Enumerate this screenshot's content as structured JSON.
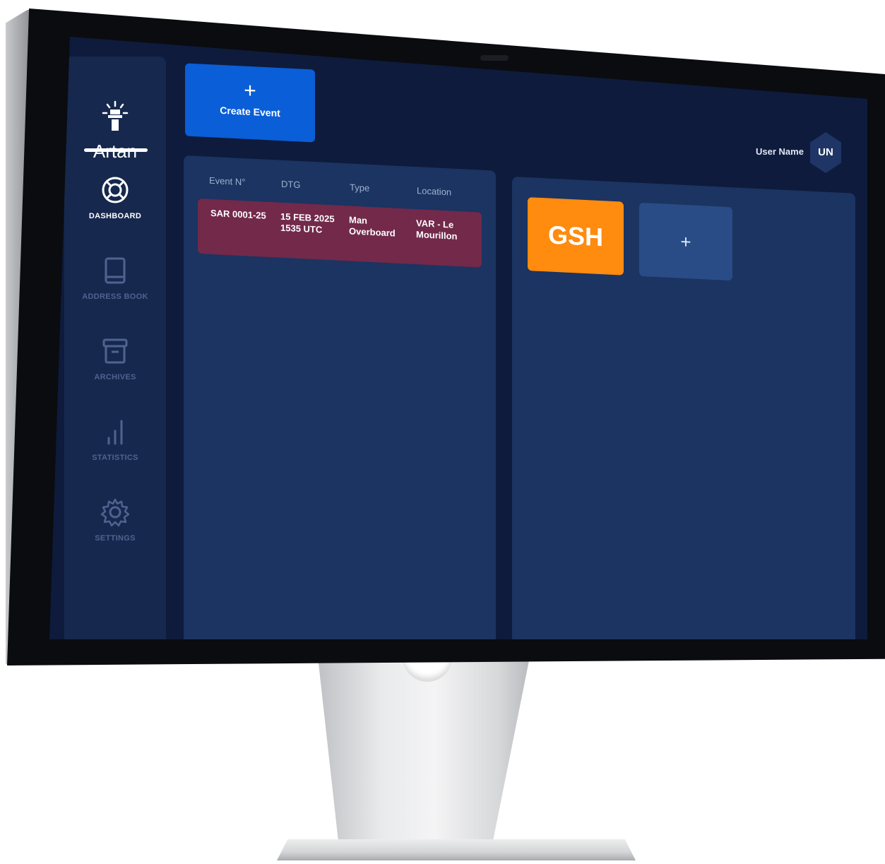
{
  "app": {
    "name": "Artan"
  },
  "sidebar": {
    "items": [
      {
        "label": "DASHBOARD",
        "icon": "lifebuoy-icon",
        "active": true
      },
      {
        "label": "ADDRESS BOOK",
        "icon": "book-icon",
        "active": false
      },
      {
        "label": "ARCHIVES",
        "icon": "archive-box-icon",
        "active": false
      },
      {
        "label": "STATISTICS",
        "icon": "bar-chart-icon",
        "active": false
      },
      {
        "label": "SETTINGS",
        "icon": "gear-icon",
        "active": false
      }
    ]
  },
  "toolbar": {
    "create_icon": "+",
    "create_label": "Create Event"
  },
  "user": {
    "name": "User Name",
    "initials": "UN"
  },
  "events": {
    "columns": [
      "Event N°",
      "DTG",
      "Type",
      "Location"
    ],
    "rows": [
      {
        "event_no": "SAR 0001-25",
        "dtg_line1": "15 FEB 2025",
        "dtg_line2": "1535 UTC",
        "type_line1": "Man",
        "type_line2": "Overboard",
        "location_line1": "VAR - Le",
        "location_line2": "Mourillon"
      }
    ]
  },
  "workspace": {
    "tiles": [
      {
        "label": "GSH",
        "color": "#ff8b0f"
      }
    ],
    "add_label": "+"
  },
  "colors": {
    "screen_bg": "#0e1b3c",
    "panel_bg": "#1b3461",
    "sidebar_bg": "#16284d",
    "accent_blue": "#0a5ed7",
    "event_row": "#72294a",
    "tile_orange": "#ff8b0f",
    "muted_text": "#4f6391"
  }
}
